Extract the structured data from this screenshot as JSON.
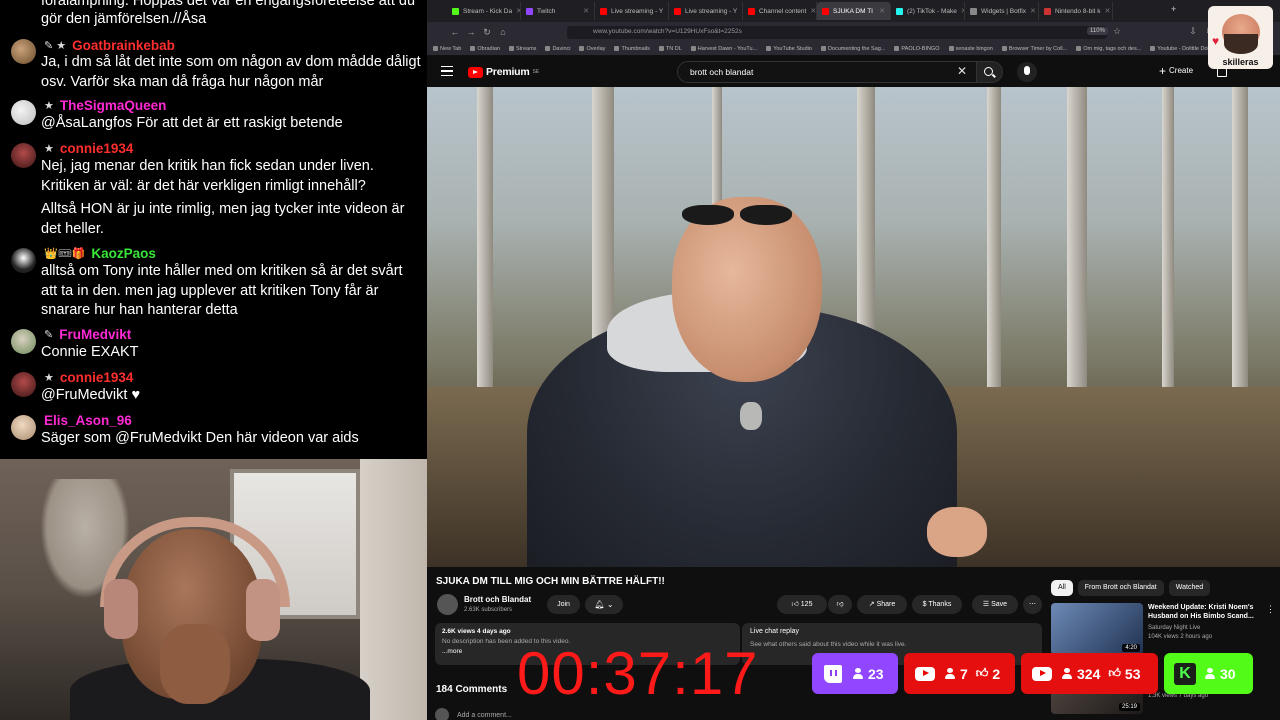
{
  "chat": {
    "top_fragment": "förälampning. Hoppas det var en engångsföreteelse att du gör den jämförelsen.//Åsa",
    "messages": [
      {
        "badges": "✎ ★",
        "user": "Goatbrainkebab",
        "color": "#ff2e2e",
        "text": "Ja, i dm så låt det inte som om någon av dom mådde dåligt osv. Varför ska man då fråga hur någon mår"
      },
      {
        "badges": "★",
        "user": "TheSigmaQueen",
        "color": "#ff2ad4",
        "text": "@ÅsaLangfos För att det är ett raskigt betende"
      },
      {
        "badges": "★",
        "user": "connie1934",
        "color": "#ff2e2e",
        "text": "Nej, jag menar den kritik han fick sedan under liven. Kritiken är väl: är det här verkligen rimligt innehåll?",
        "text2": "Alltså HON är ju inte rimlig, men jag tycker inte videon är det heller."
      },
      {
        "badges": "👑🎟🎁",
        "user": "KaozPaos",
        "color": "#39e639",
        "text": "alltså om Tony inte håller med om kritiken så är det svårt att ta in den. men jag upplever att kritiken Tony får är snarare hur han hanterar detta"
      },
      {
        "badges": "✎",
        "user": "FruMedvikt",
        "color": "#ff2ad4",
        "text": "Connie EXAKT"
      },
      {
        "badges": "★",
        "user": "connie1934",
        "color": "#ff2e2e",
        "text": "@FruMedvikt ♥"
      },
      {
        "badges": "",
        "user": "Elis_Ason_96",
        "color": "#ff2ad4",
        "text": "Säger som @FruMedvikt Den här videon var aids"
      }
    ]
  },
  "browser": {
    "tabs": [
      {
        "label": "Stream - Kick Da",
        "color": "#53fc18"
      },
      {
        "label": "Twitch",
        "color": "#9146ff"
      },
      {
        "label": "Live streaming - Y",
        "color": "#ff0000"
      },
      {
        "label": "Live streaming - Y",
        "color": "#ff0000"
      },
      {
        "label": "Channel content",
        "color": "#ff0000"
      },
      {
        "label": "SJUKA DM TI",
        "color": "#ff0000",
        "active": true
      },
      {
        "label": "(2) TikTok - Make",
        "color": "#25f4ee"
      },
      {
        "label": "Widgets | Botfix",
        "color": "#888888"
      },
      {
        "label": "Nintendo 8-bit k",
        "color": "#cc3333"
      }
    ],
    "url": "www.youtube.com/watch?v=U129HUxFso&t=2252s",
    "zoom": "110%",
    "bookmarks": [
      "New Tab",
      "Obradian",
      "Streams",
      "Davinci",
      "Overlay",
      "Thumbnails",
      "TN DL",
      "Harvest Dawn - YouTu...",
      "YouTube Studio",
      "Documenting the Sag...",
      "PAOLO-BINGO",
      "senaste bingon",
      "Browser Timer by Coll...",
      "Om mig, tags och des...",
      "Youtube - Dolittle Dok..."
    ]
  },
  "youtube": {
    "logo": "Premium",
    "logo_sup": "SE",
    "search_value": "brott och blandat",
    "create_label": "Create",
    "video_title": "SJUKA DM TILL MIG OCH MIN BÄTTRE HÄLFT!!",
    "channel": "Brott och Blandat",
    "subscribers": "2.63K subscribers",
    "join": "Join",
    "likes": "125",
    "share": "Share",
    "thanks": "Thanks",
    "save": "Save",
    "desc_meta": "2.6K views  4 days ago",
    "desc_line": "No description has been added to this video.",
    "desc_more": "...more",
    "live_replay_title": "Live chat replay",
    "live_replay_sub": "See what others said about this video while it was live.",
    "comments": "184 Comments",
    "add_comment": "Add a comment...",
    "chips": [
      "All",
      "From Brott och Blandat",
      "Watched"
    ],
    "side": [
      {
        "title": "Weekend Update: Kristi Noem's Husband on His Bimbo Scand...",
        "channel": "Saturday Night Live",
        "views": "104K views  2 hours ago",
        "duration": "4:20"
      },
      {
        "title": "",
        "channel": "",
        "views": "1.3K views  7 days ago",
        "duration": "25:19"
      }
    ]
  },
  "overlay": {
    "timer": "00:37:17",
    "twitch_viewers": "23",
    "yt1_viewers": "7",
    "yt1_likes": "2",
    "yt2_viewers": "324",
    "yt2_likes": "53",
    "kick_viewers": "30",
    "avatar_label": "skilleras",
    "colors": {
      "twitch": "#9146ff",
      "youtube": "#e60f0f",
      "kick": "#53fc18",
      "timer": "#ff1a1a"
    }
  }
}
